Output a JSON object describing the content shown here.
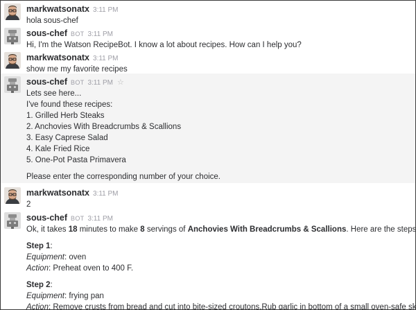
{
  "messages": [
    {
      "user": "markwatsonatx",
      "time": "3:11 PM",
      "text": "hola sous-chef"
    },
    {
      "user": "sous-chef",
      "bot_badge": "BOT",
      "time": "3:11 PM",
      "text": "Hi, I'm the Watson RecipeBot. I know a lot about recipes. How can I help you?"
    },
    {
      "user": "markwatsonatx",
      "time": "3:11 PM",
      "text": "show me my favorite recipes"
    },
    {
      "user": "sous-chef",
      "bot_badge": "BOT",
      "time": "3:11 PM",
      "star_icon": "☆",
      "intro": "Lets see here...",
      "list_heading": "I've found these recipes:",
      "recipes": [
        "1. Grilled Herb Steaks",
        "2. Anchovies With Breadcrumbs & Scallions",
        "3. Easy Caprese Salad",
        "4. Kale Fried Rice",
        "5. One-Pot Pasta Primavera"
      ],
      "prompt": "Please enter the corresponding number of your choice."
    },
    {
      "user": "markwatsonatx",
      "time": "3:11 PM",
      "text": "2"
    },
    {
      "user": "sous-chef",
      "bot_badge": "BOT",
      "time": "3:11 PM",
      "summary": {
        "pre": "Ok, it takes ",
        "minutes": "18",
        "mid1": " minutes to make ",
        "servings": "8",
        "mid2": " servings of ",
        "recipe": "Anchovies With Breadcrumbs & Scallions",
        "post": ". Here are the steps:"
      },
      "steps": [
        {
          "title": "Step 1",
          "equipment_label": "Equipment",
          "equipment": "oven",
          "action_label": "Action",
          "action": "Preheat oven to 400 F."
        },
        {
          "title": "Step 2",
          "equipment_label": "Equipment",
          "equipment": "frying pan",
          "action_label": "Action",
          "action": "Remove crusts from bread and cut into bite-sized croutons.Rub garlic in bottom of a small oven-safe skillet,"
        }
      ]
    }
  ]
}
